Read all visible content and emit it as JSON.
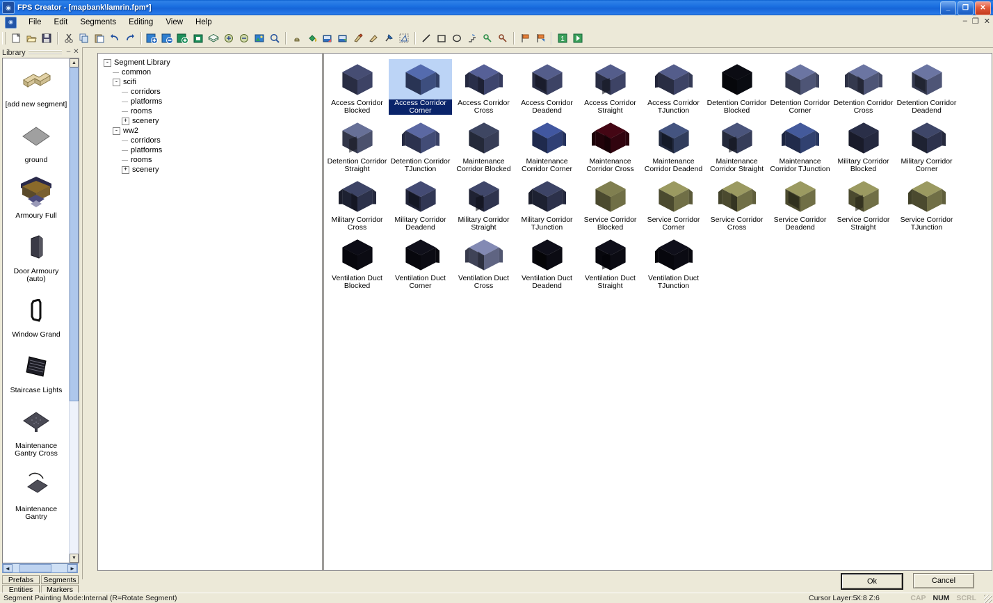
{
  "titlebar": {
    "title": "FPS Creator - [mapbank\\lamrin.fpm*]",
    "app_icon": "fps-creator-icon",
    "minimize": "_",
    "maximize": "❐",
    "close": "✕"
  },
  "menubar": {
    "items": [
      "File",
      "Edit",
      "Segments",
      "Editing",
      "View",
      "Help"
    ],
    "mdi_minimize": "–",
    "mdi_restore": "❐",
    "mdi_close": "✕"
  },
  "toolbar": {
    "groups": [
      [
        "new-file",
        "open-file",
        "save-file"
      ],
      [
        "cut",
        "copy",
        "paste",
        "undo",
        "redo"
      ],
      [
        "add-segment",
        "remove-segment",
        "replace-segment",
        "segment-properties",
        "layers",
        "zoom-in",
        "zoom-out",
        "texture-view",
        "find"
      ],
      [
        "light",
        "paint-bucket",
        "import-entity",
        "export-entity",
        "paint-tool",
        "erase-tool",
        "pin-tool",
        "area-select"
      ],
      [
        "line-tool",
        "rectangle-tool",
        "ellipse-tool",
        "stairs-tool",
        "link-tool",
        "unlink-tool"
      ],
      [
        "marker-start",
        "marker-end"
      ],
      [
        "test-level",
        "build-game"
      ]
    ]
  },
  "library": {
    "header_title": "Library",
    "collapse_label": "–",
    "close_label": "✕",
    "items": [
      {
        "label": "[add new segment]",
        "icon": "add-new-segment-thumb"
      },
      {
        "label": "ground",
        "icon": "ground-thumb"
      },
      {
        "label": "Armoury Full",
        "icon": "armoury-full-thumb"
      },
      {
        "label": "Door Armoury (auto)",
        "icon": "door-armoury-thumb"
      },
      {
        "label": "Window Grand",
        "icon": "window-grand-thumb"
      },
      {
        "label": "Staircase Lights",
        "icon": "staircase-lights-thumb"
      },
      {
        "label": "Maintenance Gantry Cross",
        "icon": "maintenance-gantry-cross-thumb"
      },
      {
        "label": "Maintenance Gantry",
        "icon": "maintenance-gantry-thumb"
      }
    ],
    "tabs": [
      "Prefabs",
      "Segments",
      "Entities",
      "Markers"
    ],
    "scroll_up": "▲",
    "scroll_down": "▼",
    "scroll_left": "◄",
    "scroll_right": "►"
  },
  "tree": {
    "root": "Segment Library",
    "nodes": [
      {
        "label": "Segment Library",
        "depth": 0,
        "box": "-"
      },
      {
        "label": "common",
        "depth": 1,
        "box": ""
      },
      {
        "label": "scifi",
        "depth": 1,
        "box": "-"
      },
      {
        "label": "corridors",
        "depth": 2,
        "box": ""
      },
      {
        "label": "platforms",
        "depth": 2,
        "box": ""
      },
      {
        "label": "rooms",
        "depth": 2,
        "box": ""
      },
      {
        "label": "scenery",
        "depth": 2,
        "box": "+"
      },
      {
        "label": "ww2",
        "depth": 1,
        "box": "-"
      },
      {
        "label": "corridors",
        "depth": 2,
        "box": ""
      },
      {
        "label": "platforms",
        "depth": 2,
        "box": ""
      },
      {
        "label": "rooms",
        "depth": 2,
        "box": ""
      },
      {
        "label": "scenery",
        "depth": 2,
        "box": "+"
      }
    ]
  },
  "grid": {
    "selected_index": 1,
    "items": [
      {
        "label": "Access Corridor Blocked",
        "shape": "blocked",
        "tint": "#3a4060"
      },
      {
        "label": "Access Corridor Corner",
        "shape": "corner",
        "tint": "#3a4a78"
      },
      {
        "label": "Access Corridor Cross",
        "shape": "cross",
        "tint": "#3b4268"
      },
      {
        "label": "Access Corridor Deadend",
        "shape": "deadend",
        "tint": "#3a4060"
      },
      {
        "label": "Access Corridor Straight",
        "shape": "straight",
        "tint": "#3a4060"
      },
      {
        "label": "Access Corridor TJunction",
        "shape": "tjunction",
        "tint": "#3a4060"
      },
      {
        "label": "Detention Corridor Blocked",
        "shape": "blocked",
        "tint": "#090a10"
      },
      {
        "label": "Detention Corridor Corner",
        "shape": "corner",
        "tint": "#4a5170"
      },
      {
        "label": "Detention Corridor Cross",
        "shape": "cross",
        "tint": "#4a5170"
      },
      {
        "label": "Detention Corridor Deadend",
        "shape": "deadend",
        "tint": "#4a5170"
      },
      {
        "label": "Detention Corridor Straight",
        "shape": "straight",
        "tint": "#474d68"
      },
      {
        "label": "Detention Corridor TJunction",
        "shape": "tjunction",
        "tint": "#3f4870"
      },
      {
        "label": "Maintenance Corridor Blocked",
        "shape": "blocked",
        "tint": "#343a52"
      },
      {
        "label": "Maintenance Corridor Corner",
        "shape": "corner",
        "tint": "#2d3c6e"
      },
      {
        "label": "Maintenance Corridor Cross",
        "shape": "cross",
        "tint": "#2f4versions"
      },
      {
        "label": "Maintenance Corridor Deadend",
        "shape": "deadend",
        "tint": "#2f3a58"
      },
      {
        "label": "Maintenance Corridor Straight",
        "shape": "straight",
        "tint": "#333a55"
      },
      {
        "label": "Maintenance Corridor TJunction",
        "shape": "tjunction",
        "tint": "#2f3e6b"
      },
      {
        "label": "Military Corridor Blocked",
        "shape": "blocked",
        "tint": "#23273c"
      },
      {
        "label": "Military Corridor Corner",
        "shape": "corner",
        "tint": "#2b3048"
      },
      {
        "label": "Military Corridor Cross",
        "shape": "cross",
        "tint": "#2a2f46"
      },
      {
        "label": "Military Corridor Deadend",
        "shape": "deadend",
        "tint": "#2f3450"
      },
      {
        "label": "Military Corridor Straight",
        "shape": "straight",
        "tint": "#2c3149"
      },
      {
        "label": "Military Corridor TJunction",
        "shape": "tjunction",
        "tint": "#2a2f46"
      },
      {
        "label": "Service Corridor Blocked",
        "shape": "blocked",
        "tint": "#6b6a43"
      },
      {
        "label": "Service Corridor Corner",
        "shape": "corner",
        "tint": "#6b6a43"
      },
      {
        "label": "Service Corridor Cross",
        "shape": "cross",
        "tint": "#6b6a43"
      },
      {
        "label": "Service Corridor Deadend",
        "shape": "deadend",
        "tint": "#6b6a43"
      },
      {
        "label": "Service Corridor Straight",
        "shape": "straight",
        "tint": "#6b6a43"
      },
      {
        "label": "Service Corridor TJunction",
        "shape": "tjunction",
        "tint": "#6b6a43"
      },
      {
        "label": "Ventilation Duct Blocked",
        "shape": "blocked",
        "tint": "#0a0a12"
      },
      {
        "label": "Ventilation Duct Corner",
        "shape": "corner",
        "tint": "#0a0a12"
      },
      {
        "label": "Ventilation Duct Cross",
        "shape": "cross",
        "tint": "#5a5f7c"
      },
      {
        "label": "Ventilation Duct Deadend",
        "shape": "deadend",
        "tint": "#0a0a12"
      },
      {
        "label": "Ventilation Duct Straight",
        "shape": "straight",
        "tint": "#0a0a12"
      },
      {
        "label": "Ventilation Duct TJunction",
        "shape": "tjunction",
        "tint": "#0a0a12"
      }
    ]
  },
  "dialog": {
    "ok_label": "Ok",
    "cancel_label": "Cancel"
  },
  "statusbar": {
    "mode": "Segment Painting Mode:Internal (R=Rotate Segment)",
    "cursor_layer": "Cursor Layer:5",
    "coords": "X:8  Z:6",
    "caps": "CAP",
    "num": "NUM",
    "scroll": "SCRL"
  },
  "colors": {
    "title_blue": "#1a6fe0",
    "panel": "#ece9d8",
    "selection_blue": "#0a246a",
    "selection_fill": "#bcd4f6"
  }
}
